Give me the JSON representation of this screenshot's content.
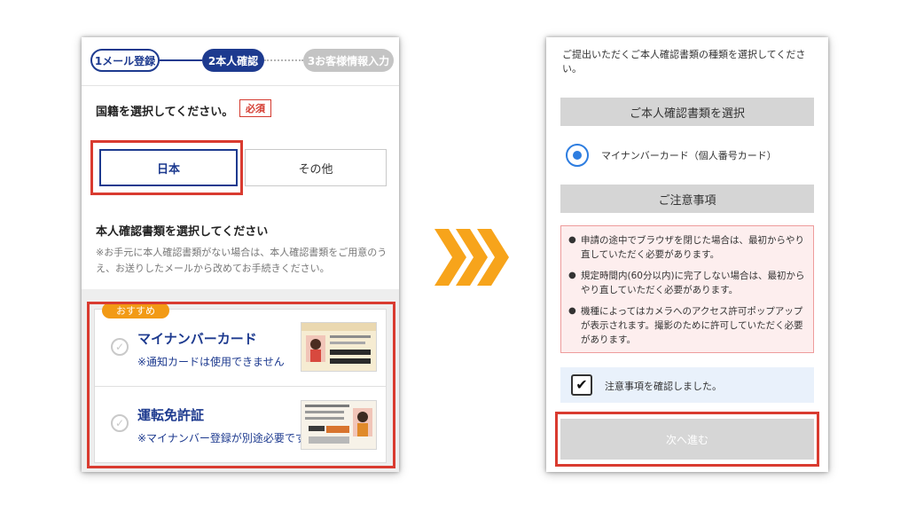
{
  "left_screen": {
    "stepper": {
      "step1": "1メール登録",
      "step2": "2本人確認",
      "step3": "3お客様情報入力"
    },
    "nationality": {
      "heading": "国籍を選択してください。",
      "required_badge": "必須",
      "option_japan": "日本",
      "option_other": "その他"
    },
    "document_selection": {
      "heading": "本人確認書類を選択してください",
      "note": "※お手元に本人確認書類がない場合は、本人確認書類をご用意のうえ、お送りしたメールから改めてお手続きください。"
    },
    "cards": [
      {
        "badge": "おすすめ",
        "title": "マイナンバーカード",
        "subtitle": "※通知カードは使用できません",
        "image_icon": "id-card-image"
      },
      {
        "title": "運転免許証",
        "subtitle": "※マイナンバー登録が別途必要です",
        "image_icon": "drivers-license-image"
      }
    ]
  },
  "transition": {
    "icon": "triple-chevron-right-icon",
    "color": "#F7A41B"
  },
  "right_screen": {
    "intro": "ご提出いただくご本人確認書類の種類を選択してください。",
    "section_doc_title": "ご本人確認書類を選択",
    "selected_doc": "マイナンバーカード（個人番号カード）",
    "section_notes_title": "ご注意事項",
    "notes": [
      "申請の途中でブラウザを閉じた場合は、最初からやり直していただく必要があります。",
      "規定時間内(60分以内)に完了しない場合は、最初からやり直していただく必要があります。",
      "機種によってはカメラへのアクセス許可ポップアップが表示されます。撮影のために許可していただく必要があります。"
    ],
    "confirm_label": "注意事項を確認しました。",
    "next_button": "次へ進む"
  },
  "colors": {
    "brand_navy": "#1D3A8F",
    "highlight_red": "#D93B30",
    "badge_orange": "#F29A15",
    "radio_blue": "#2D7DE0",
    "warning_bg": "#FDEEEE"
  }
}
